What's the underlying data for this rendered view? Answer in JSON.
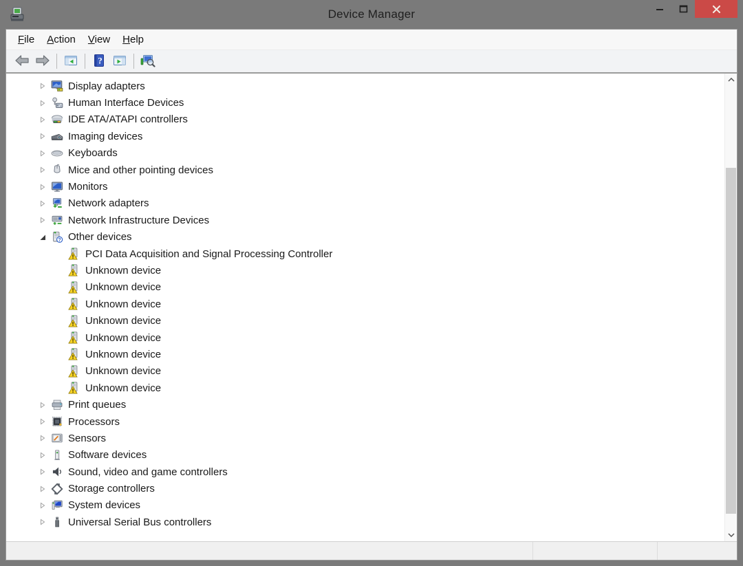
{
  "window": {
    "title": "Device Manager",
    "app_icon": "device-manager-icon",
    "controls": [
      {
        "name": "minimize",
        "icon": "minimize-icon"
      },
      {
        "name": "maximize",
        "icon": "maximize-icon"
      },
      {
        "name": "close",
        "icon": "close-icon"
      }
    ],
    "colors": {
      "titlebar": "#7a7a7a",
      "close_button": "#cb4a47",
      "warning": "#f7d426"
    }
  },
  "menu": {
    "items": [
      "File",
      "Action",
      "View",
      "Help"
    ]
  },
  "toolbar": {
    "buttons": [
      {
        "name": "back",
        "icon": "back-arrow-icon"
      },
      {
        "name": "forward",
        "icon": "forward-arrow-icon"
      },
      {
        "type": "separator"
      },
      {
        "name": "show-hide-console-tree",
        "icon": "console-tree-icon"
      },
      {
        "type": "separator"
      },
      {
        "name": "help",
        "icon": "help-book-icon"
      },
      {
        "name": "show-hide-action-pane",
        "icon": "action-pane-icon"
      },
      {
        "type": "separator"
      },
      {
        "name": "scan-for-hardware-changes",
        "icon": "scan-computer-icon"
      }
    ]
  },
  "tree": {
    "items": [
      {
        "label": "Display adapters",
        "icon": "display-adapter",
        "level": 0,
        "state": "collapsed"
      },
      {
        "label": "Human Interface Devices",
        "icon": "human-interface",
        "level": 0,
        "state": "collapsed"
      },
      {
        "label": "IDE ATA/ATAPI controllers",
        "icon": "ide-controller",
        "level": 0,
        "state": "collapsed"
      },
      {
        "label": "Imaging devices",
        "icon": "imaging-device",
        "level": 0,
        "state": "collapsed"
      },
      {
        "label": "Keyboards",
        "icon": "keyboard",
        "level": 0,
        "state": "collapsed"
      },
      {
        "label": "Mice and other pointing devices",
        "icon": "mouse",
        "level": 0,
        "state": "collapsed"
      },
      {
        "label": "Monitors",
        "icon": "monitor",
        "level": 0,
        "state": "collapsed"
      },
      {
        "label": "Network adapters",
        "icon": "network-adapter",
        "level": 0,
        "state": "collapsed"
      },
      {
        "label": "Network Infrastructure Devices",
        "icon": "network-infrastructure",
        "level": 0,
        "state": "collapsed"
      },
      {
        "label": "Other devices",
        "icon": "other-device",
        "level": 0,
        "state": "expanded"
      },
      {
        "label": "PCI Data Acquisition and Signal Processing Controller",
        "icon": "unknown-device-warning",
        "level": 1,
        "state": "leaf"
      },
      {
        "label": "Unknown device",
        "icon": "unknown-device-warning",
        "level": 1,
        "state": "leaf"
      },
      {
        "label": "Unknown device",
        "icon": "unknown-device-warning",
        "level": 1,
        "state": "leaf"
      },
      {
        "label": "Unknown device",
        "icon": "unknown-device-warning",
        "level": 1,
        "state": "leaf"
      },
      {
        "label": "Unknown device",
        "icon": "unknown-device-warning",
        "level": 1,
        "state": "leaf"
      },
      {
        "label": "Unknown device",
        "icon": "unknown-device-warning",
        "level": 1,
        "state": "leaf"
      },
      {
        "label": "Unknown device",
        "icon": "unknown-device-warning",
        "level": 1,
        "state": "leaf"
      },
      {
        "label": "Unknown device",
        "icon": "unknown-device-warning",
        "level": 1,
        "state": "leaf"
      },
      {
        "label": "Unknown device",
        "icon": "unknown-device-warning",
        "level": 1,
        "state": "leaf"
      },
      {
        "label": "Print queues",
        "icon": "printer",
        "level": 0,
        "state": "collapsed"
      },
      {
        "label": "Processors",
        "icon": "processor",
        "level": 0,
        "state": "collapsed"
      },
      {
        "label": "Sensors",
        "icon": "sensor",
        "level": 0,
        "state": "collapsed"
      },
      {
        "label": "Software devices",
        "icon": "software-device",
        "level": 0,
        "state": "collapsed"
      },
      {
        "label": "Sound, video and game controllers",
        "icon": "speaker",
        "level": 0,
        "state": "collapsed"
      },
      {
        "label": "Storage controllers",
        "icon": "storage-controller",
        "level": 0,
        "state": "collapsed"
      },
      {
        "label": "System devices",
        "icon": "system-device",
        "level": 0,
        "state": "collapsed"
      },
      {
        "label": "Universal Serial Bus controllers",
        "icon": "usb-controller",
        "level": 0,
        "state": "collapsed"
      }
    ]
  },
  "scrollbar": {
    "orientation": "vertical",
    "up_icon": "chevron-up-icon",
    "down_icon": "chevron-down-icon"
  },
  "statusbar": {
    "cells": [
      "",
      "",
      ""
    ]
  }
}
